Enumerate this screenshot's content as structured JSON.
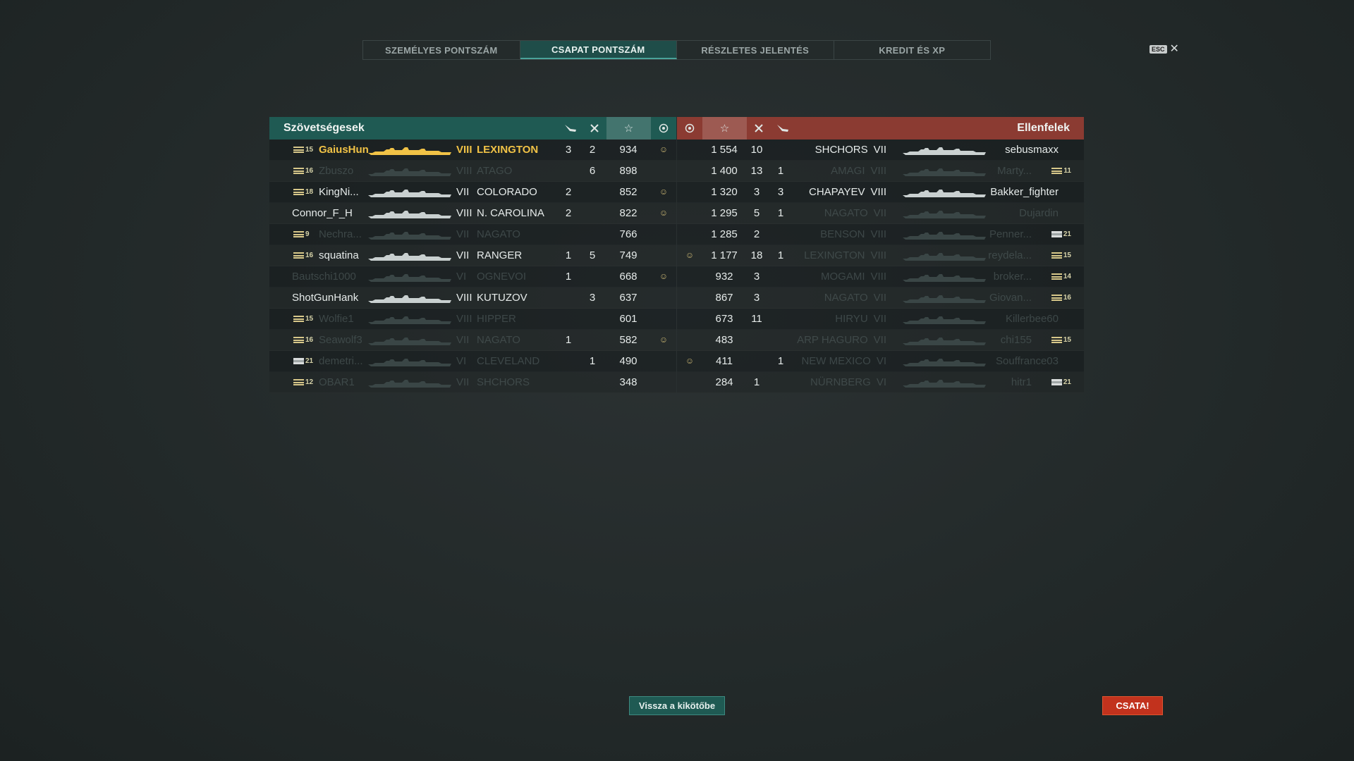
{
  "tabs": [
    {
      "label": "SZEMÉLYES PONTSZÁM",
      "active": false
    },
    {
      "label": "CSAPAT PONTSZÁM",
      "active": true
    },
    {
      "label": "RÉSZLETES JELENTÉS",
      "active": false
    },
    {
      "label": "KREDIT ÉS XP",
      "active": false
    }
  ],
  "esc_label": "ESC",
  "allies": {
    "title": "Szövetségesek",
    "rows": [
      {
        "rank": "15",
        "player": "GaiusHun",
        "tier": "VIII",
        "ship": "LEXINGTON",
        "c1": "3",
        "c2": "2",
        "score": "934",
        "ribbon": "☺",
        "state": "self"
      },
      {
        "rank": "16",
        "player": "Zbuszo",
        "tier": "VIII",
        "ship": "ATAGO",
        "c1": "",
        "c2": "6",
        "score": "898",
        "ribbon": "",
        "state": "dead"
      },
      {
        "rank": "18",
        "player": "KingNi...",
        "tier": "VII",
        "ship": "COLORADO",
        "c1": "2",
        "c2": "",
        "score": "852",
        "ribbon": "☺",
        "state": "alive"
      },
      {
        "rank": "",
        "player": "Connor_F_H",
        "tier": "VIII",
        "ship": "N. CAROLINA",
        "c1": "2",
        "c2": "",
        "score": "822",
        "ribbon": "☺",
        "state": "alive"
      },
      {
        "rank": "9",
        "player": "Nechra...",
        "tier": "VII",
        "ship": "NAGATO",
        "c1": "",
        "c2": "",
        "score": "766",
        "ribbon": "",
        "state": "dead"
      },
      {
        "rank": "16",
        "player": "squatina",
        "tier": "VII",
        "ship": "RANGER",
        "c1": "1",
        "c2": "5",
        "score": "749",
        "ribbon": "",
        "state": "alive"
      },
      {
        "rank": "",
        "player": "Bautschi1000",
        "tier": "VI",
        "ship": "OGNEVOI",
        "c1": "1",
        "c2": "",
        "score": "668",
        "ribbon": "☺",
        "state": "dead"
      },
      {
        "rank": "",
        "player": "ShotGunHank",
        "tier": "VIII",
        "ship": "KUTUZOV",
        "c1": "",
        "c2": "3",
        "score": "637",
        "ribbon": "",
        "state": "alive"
      },
      {
        "rank": "15",
        "player": "Wolfie1",
        "tier": "VIII",
        "ship": "HIPPER",
        "c1": "",
        "c2": "",
        "score": "601",
        "ribbon": "",
        "state": "dead"
      },
      {
        "rank": "16",
        "player": "Seawolf3",
        "tier": "VII",
        "ship": "NAGATO",
        "c1": "1",
        "c2": "",
        "score": "582",
        "ribbon": "☺",
        "state": "dead"
      },
      {
        "rank": "21",
        "player": "demetri...",
        "tier": "VI",
        "ship": "CLEVELAND",
        "c1": "",
        "c2": "1",
        "score": "490",
        "ribbon": "",
        "state": "dead",
        "flag": true
      },
      {
        "rank": "12",
        "player": "OBAR1",
        "tier": "VII",
        "ship": "SHCHORS",
        "c1": "",
        "c2": "",
        "score": "348",
        "ribbon": "",
        "state": "dead"
      }
    ]
  },
  "enemies": {
    "title": "Ellenfelek",
    "rows": [
      {
        "ribbon": "",
        "score": "1 554",
        "c1": "10",
        "c2": "",
        "ship": "SHCHORS",
        "tier": "VII",
        "player": "sebusmaxx",
        "rank": "",
        "state": "alive"
      },
      {
        "ribbon": "",
        "score": "1 400",
        "c1": "13",
        "c2": "1",
        "ship": "AMAGI",
        "tier": "VIII",
        "player": "Marty...",
        "rank": "11",
        "state": "dead"
      },
      {
        "ribbon": "",
        "score": "1 320",
        "c1": "3",
        "c2": "3",
        "ship": "CHAPAYEV",
        "tier": "VIII",
        "player": "Bakker_fighter",
        "rank": "",
        "state": "alive"
      },
      {
        "ribbon": "",
        "score": "1 295",
        "c1": "5",
        "c2": "1",
        "ship": "NAGATO",
        "tier": "VII",
        "player": "Dujardin",
        "rank": "",
        "state": "dead"
      },
      {
        "ribbon": "",
        "score": "1 285",
        "c1": "2",
        "c2": "",
        "ship": "BENSON",
        "tier": "VIII",
        "player": "Penner...",
        "rank": "21",
        "state": "dead",
        "flag": true
      },
      {
        "ribbon": "☺",
        "score": "1 177",
        "c1": "18",
        "c2": "1",
        "ship": "LEXINGTON",
        "tier": "VIII",
        "player": "reydela...",
        "rank": "15",
        "state": "dead"
      },
      {
        "ribbon": "",
        "score": "932",
        "c1": "3",
        "c2": "",
        "ship": "MOGAMI",
        "tier": "VIII",
        "player": "broker...",
        "rank": "14",
        "state": "dead"
      },
      {
        "ribbon": "",
        "score": "867",
        "c1": "3",
        "c2": "",
        "ship": "NAGATO",
        "tier": "VII",
        "player": "Giovan...",
        "rank": "16",
        "state": "dead"
      },
      {
        "ribbon": "",
        "score": "673",
        "c1": "11",
        "c2": "",
        "ship": "HIRYU",
        "tier": "VII",
        "player": "Killerbee60",
        "rank": "",
        "state": "dead"
      },
      {
        "ribbon": "",
        "score": "483",
        "c1": "",
        "c2": "",
        "ship": "ARP HAGURO",
        "tier": "VII",
        "player": "chi155",
        "rank": "15",
        "state": "dead"
      },
      {
        "ribbon": "☺",
        "score": "411",
        "c1": "",
        "c2": "1",
        "ship": "NEW MEXICO",
        "tier": "VI",
        "player": "Souffrance03",
        "rank": "",
        "state": "dead"
      },
      {
        "ribbon": "",
        "score": "284",
        "c1": "1",
        "c2": "",
        "ship": "NÜRNBERG",
        "tier": "VI",
        "player": "hitr1",
        "rank": "21",
        "state": "dead",
        "flag": true
      }
    ]
  },
  "buttons": {
    "back": "Vissza a kikötőbe",
    "battle": "CSATA!"
  },
  "colors": {
    "allies_header": "#1f5a53",
    "enemies_header": "#8b3b32",
    "self_highlight": "#f0c246",
    "battle_button": "#c2321d"
  }
}
